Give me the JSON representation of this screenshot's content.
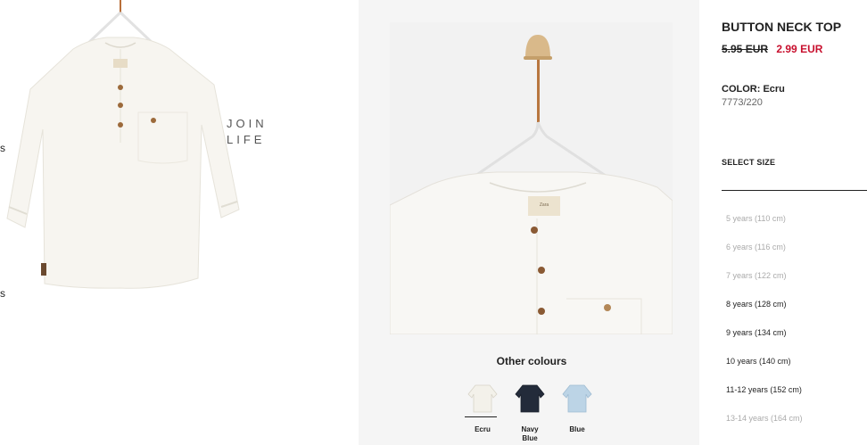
{
  "main_image": {
    "badge_line1": "JOIN",
    "badge_line2": "LIFE",
    "edge_marks": [
      "s",
      "s"
    ]
  },
  "other_colours": {
    "title": "Other colours",
    "swatches": [
      {
        "name": "Ecru",
        "color": "#f3f1ea",
        "selected": true
      },
      {
        "name": "Navy\nBlue",
        "color": "#232b3a",
        "selected": false
      },
      {
        "name": "Blue",
        "color": "#bcd4e6",
        "selected": false
      }
    ]
  },
  "product": {
    "title": "BUTTON NECK TOP",
    "old_price": "5.95 EUR",
    "new_price": "2.99 EUR",
    "color_label": "COLOR: Ecru",
    "reference": "7773/220"
  },
  "sizes": {
    "label": "SELECT SIZE",
    "options": [
      {
        "label": "5 years (110 cm)",
        "available": false
      },
      {
        "label": "6 years (116 cm)",
        "available": false
      },
      {
        "label": "7 years (122 cm)",
        "available": false
      },
      {
        "label": "8 years (128 cm)",
        "available": true
      },
      {
        "label": "9 years (134 cm)",
        "available": true
      },
      {
        "label": "10 years (140 cm)",
        "available": true
      },
      {
        "label": "11-12 years (152 cm)",
        "available": true
      },
      {
        "label": "13-14 years (164 cm)",
        "available": false
      }
    ]
  },
  "colors": {
    "price_sale": "#c8102e",
    "size_unavailable": "#aaaaaa",
    "size_available": "#222222",
    "garment": "#f7f5f0"
  }
}
